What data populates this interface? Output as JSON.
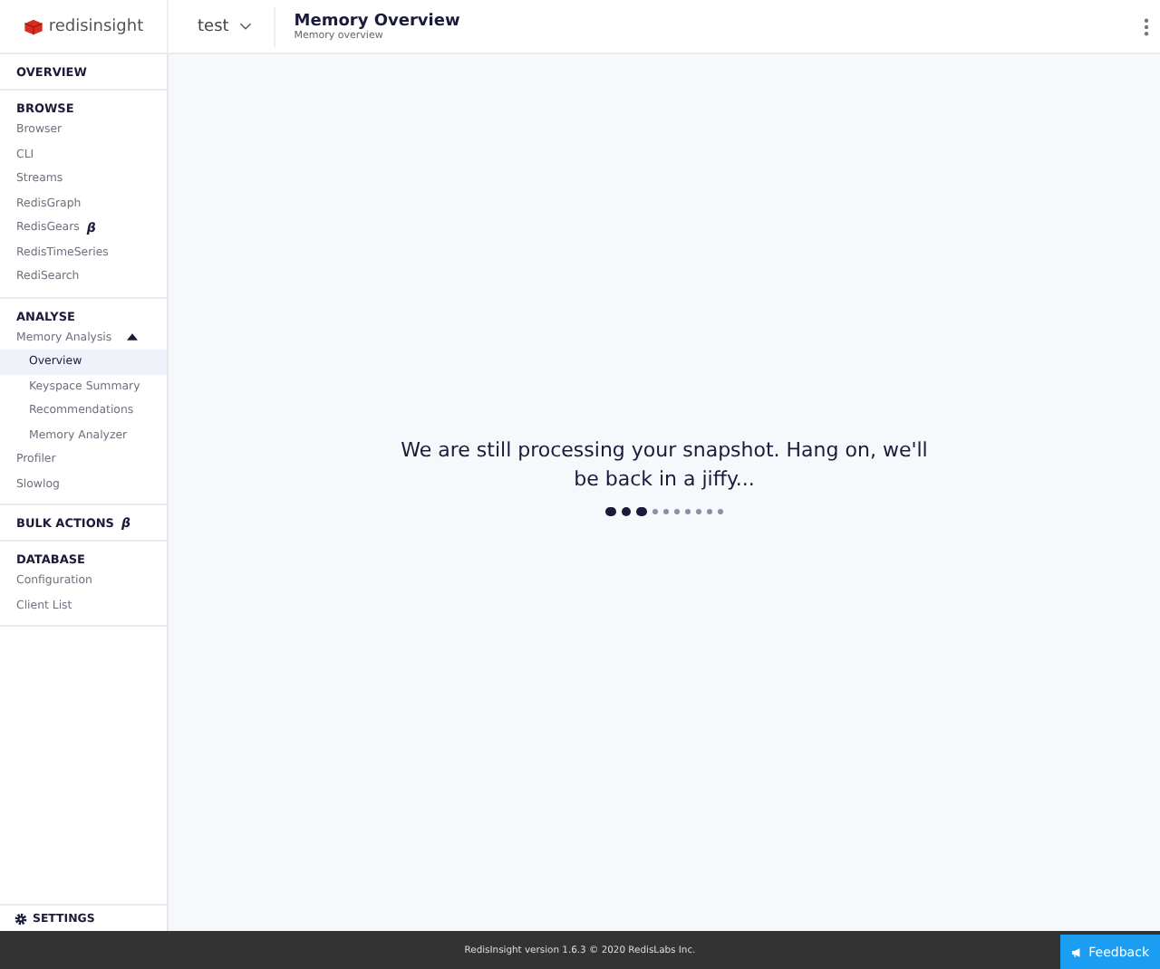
{
  "header": {
    "logo_text": "redisinsight",
    "database": "test",
    "title": "Memory Overview",
    "subtitle": "Memory overview"
  },
  "sidebar": {
    "sections": [
      {
        "heading": "OVERVIEW",
        "selected": false
      },
      {
        "heading": "BROWSE",
        "items": [
          {
            "label": "Browser",
            "selected": false
          },
          {
            "label": "CLI",
            "selected": false
          },
          {
            "label": "Streams",
            "selected": false
          },
          {
            "label": "RedisGraph",
            "selected": false
          },
          {
            "label": "RedisGears",
            "beta": "β",
            "selected": false
          },
          {
            "label": "RedisTimeSeries",
            "selected": false
          },
          {
            "label": "RediSearch",
            "selected": false
          }
        ]
      },
      {
        "heading": "ANALYSE",
        "items": [
          {
            "label": "Memory Analysis",
            "expanded": true,
            "selected": false,
            "children": [
              {
                "label": "Overview",
                "selected": true
              },
              {
                "label": "Keyspace Summary",
                "selected": false
              },
              {
                "label": "Recommendations",
                "selected": false
              },
              {
                "label": "Memory Analyzer",
                "selected": false
              }
            ]
          },
          {
            "label": "Profiler",
            "selected": false
          },
          {
            "label": "Slowlog",
            "selected": false
          }
        ]
      },
      {
        "heading": "BULK ACTIONS",
        "beta": "β"
      },
      {
        "heading": "DATABASE",
        "items": [
          {
            "label": "Configuration",
            "selected": false
          },
          {
            "label": "Client List",
            "selected": false
          }
        ]
      }
    ],
    "settings": "SETTINGS"
  },
  "main": {
    "message": "We are still processing your snapshot. Hang on, we'll be back in a jiffy...",
    "loader": [
      {
        "active": true
      },
      {
        "active": true
      },
      {
        "active": true
      },
      {
        "active": false
      },
      {
        "active": false
      },
      {
        "active": false
      },
      {
        "active": false
      },
      {
        "active": false
      },
      {
        "active": false
      },
      {
        "active": false
      }
    ]
  },
  "footer": {
    "text": "RedisInsight version 1.6.3 © 2020 RedisLabs Inc.",
    "feedback": "Feedback"
  }
}
